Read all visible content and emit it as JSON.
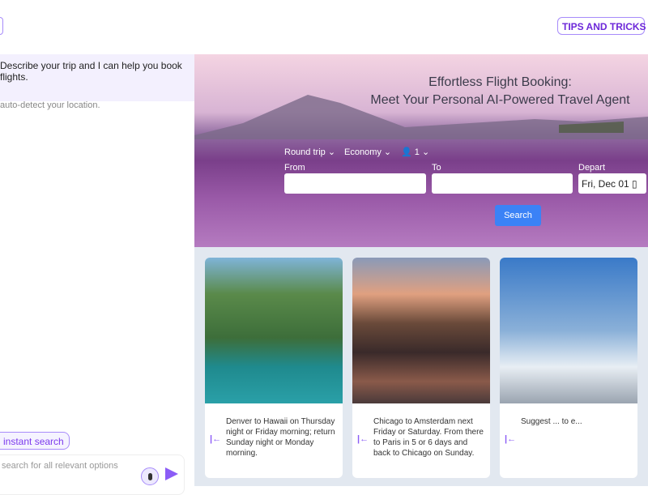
{
  "header": {
    "tips_label": "TIPS AND TRICKS"
  },
  "chat": {
    "message": "Describe your trip and I can help you book flights.",
    "location_note": "auto-detect your location.",
    "instant_search_chip": "instant search",
    "input_placeholder": "search for all relevant options"
  },
  "hero": {
    "title_line1": "Effortless Flight Booking:",
    "title_line2": "Meet Your Personal AI-Powered Travel Agent",
    "trip_type": "Round trip",
    "cabin": "Economy",
    "passengers": "1",
    "from_label": "From",
    "to_label": "To",
    "depart_label": "Depart",
    "from_value": "",
    "to_value": "",
    "depart_value": "Fri, Dec 01",
    "search_label": "Search"
  },
  "cards": [
    {
      "text": "Denver to Hawaii on Thursday night or Friday morning; return Sunday night or Monday morning."
    },
    {
      "text": "Chicago to Amsterdam next Friday or Saturday. From there to Paris in 5 or 6 days and back to Chicago on Sunday."
    },
    {
      "text": "Suggest ... to e..."
    }
  ],
  "colors": {
    "accent": "#8b5cf6",
    "search_button": "#3b82f6",
    "chat_bg": "#f3f0fe"
  }
}
